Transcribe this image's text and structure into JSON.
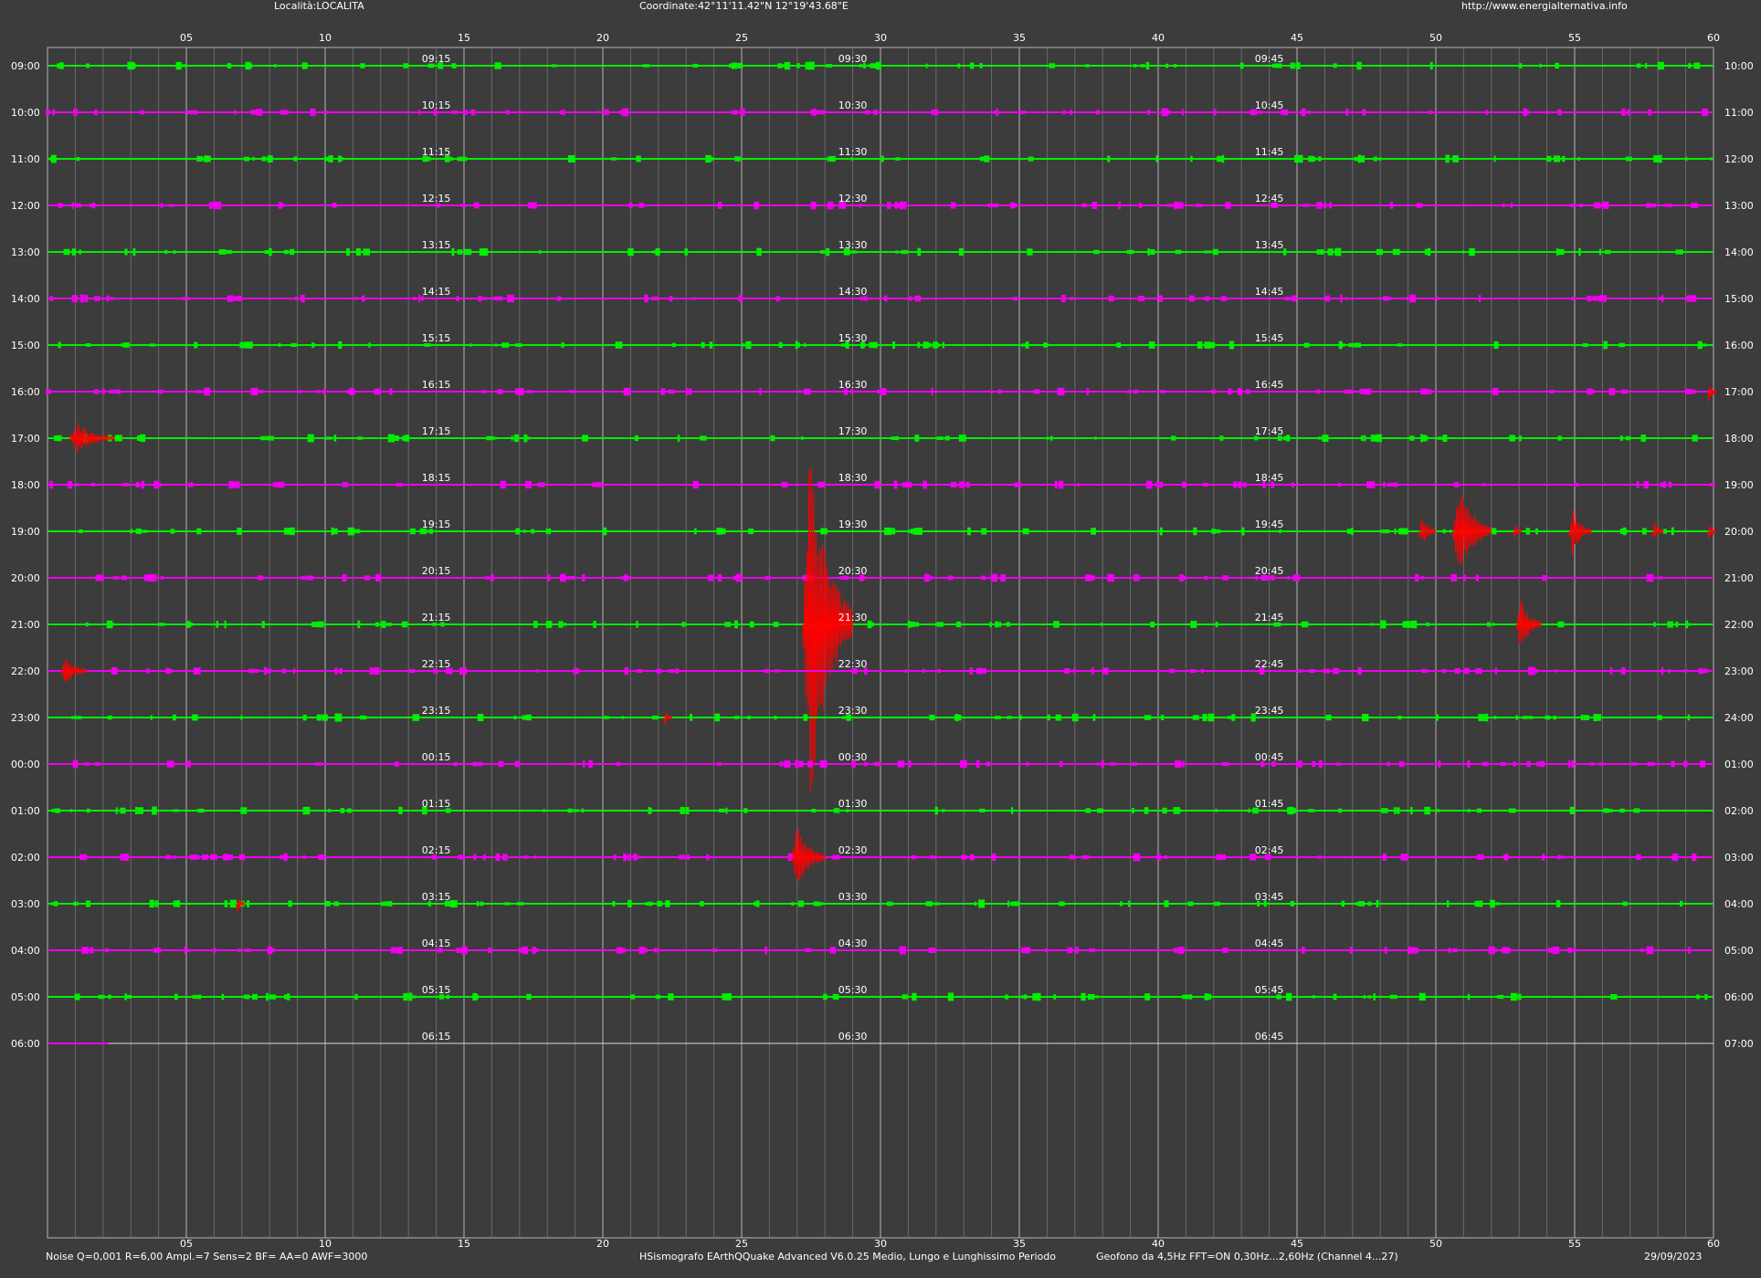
{
  "header": {
    "location": "Località:LOCALITA",
    "coordinates": "Coordinate:42°11'11.42\"N  12°19'43.68\"E",
    "website": "http://www.energialternativa.info"
  },
  "footer": {
    "params": "Noise Q=0,001 R=6,00 Ampl.=7 Sens=2 BF= AA=0 AWF=3000",
    "software": "HSismografo  EArthQQuake Advanced V6.0.25  Medio, Lungo e Lunghissimo Periodo",
    "sensor": "Geofono da 4,5Hz FFT=ON 0,30Hz...2,60Hz      (Channel 4...27)",
    "date": "29/09/2023"
  },
  "colors": {
    "background": "#3c3c3c",
    "trace_a": "#00ee00",
    "trace_b": "#ee00ee",
    "event": "#ff0000",
    "grid": "#b4b4b4"
  },
  "chart_data": {
    "type": "line",
    "x_tick_labels": [
      "05",
      "10",
      "15",
      "20",
      "25",
      "30",
      "35",
      "40",
      "45",
      "50",
      "55",
      "60"
    ],
    "xlim": [
      0,
      60
    ],
    "xlabel": "",
    "ylabel": "",
    "grid": true,
    "rows": [
      {
        "start": "09:00",
        "end": "10:00",
        "q15": "09:15",
        "q30": "09:30",
        "q45": "09:45",
        "events": []
      },
      {
        "start": "10:00",
        "end": "11:00",
        "q15": "10:15",
        "q30": "10:30",
        "q45": "10:45",
        "events": []
      },
      {
        "start": "11:00",
        "end": "12:00",
        "q15": "11:15",
        "q30": "11:30",
        "q45": "11:45",
        "events": []
      },
      {
        "start": "12:00",
        "end": "13:00",
        "q15": "12:15",
        "q30": "12:30",
        "q45": "12:45",
        "events": []
      },
      {
        "start": "13:00",
        "end": "14:00",
        "q15": "13:15",
        "q30": "13:30",
        "q45": "13:45",
        "events": []
      },
      {
        "start": "14:00",
        "end": "15:00",
        "q15": "14:15",
        "q30": "14:30",
        "q45": "14:45",
        "events": []
      },
      {
        "start": "15:00",
        "end": "16:00",
        "q15": "15:15",
        "q30": "15:30",
        "q45": "15:45",
        "events": []
      },
      {
        "start": "16:00",
        "end": "17:00",
        "q15": "16:15",
        "q30": "16:30",
        "q45": "16:45",
        "events": [
          {
            "minute": 59.8,
            "amplitude": 0.25,
            "duration": 0.3
          }
        ]
      },
      {
        "start": "17:00",
        "end": "18:00",
        "q15": "17:15",
        "q30": "17:30",
        "q45": "17:45",
        "events": [
          {
            "minute": 0.8,
            "amplitude": 0.35,
            "duration": 1.6
          }
        ]
      },
      {
        "start": "18:00",
        "end": "19:00",
        "q15": "18:15",
        "q30": "18:30",
        "q45": "18:45",
        "events": []
      },
      {
        "start": "19:00",
        "end": "20:00",
        "q15": "19:15",
        "q30": "19:30",
        "q45": "19:45",
        "events": [
          {
            "minute": 49.4,
            "amplitude": 0.35,
            "duration": 0.6
          },
          {
            "minute": 50.6,
            "amplitude": 1.1,
            "duration": 1.4
          },
          {
            "minute": 52.8,
            "amplitude": 0.2,
            "duration": 0.3
          },
          {
            "minute": 54.8,
            "amplitude": 0.55,
            "duration": 0.8
          },
          {
            "minute": 57.8,
            "amplitude": 0.25,
            "duration": 0.4
          },
          {
            "minute": 59.8,
            "amplitude": 0.2,
            "duration": 0.3
          }
        ]
      },
      {
        "start": "20:00",
        "end": "21:00",
        "q15": "20:15",
        "q30": "20:30",
        "q45": "20:45",
        "events": []
      },
      {
        "start": "21:00",
        "end": "22:00",
        "q15": "21:15",
        "q30": "21:30",
        "q45": "21:45",
        "events": [
          {
            "minute": 27.2,
            "amplitude": 3.9,
            "duration": 1.8
          },
          {
            "minute": 52.9,
            "amplitude": 0.65,
            "duration": 0.9
          }
        ]
      },
      {
        "start": "22:00",
        "end": "23:00",
        "q15": "22:15",
        "q30": "22:30",
        "q45": "22:45",
        "events": [
          {
            "minute": 0.5,
            "amplitude": 0.35,
            "duration": 0.9
          }
        ]
      },
      {
        "start": "23:00",
        "end": "24:00",
        "q15": "23:15",
        "q30": "23:30",
        "q45": "23:45",
        "events": [
          {
            "minute": 22.2,
            "amplitude": 0.2,
            "duration": 0.3
          }
        ]
      },
      {
        "start": "00:00",
        "end": "01:00",
        "q15": "00:15",
        "q30": "00:30",
        "q45": "00:45",
        "events": []
      },
      {
        "start": "01:00",
        "end": "02:00",
        "q15": "01:15",
        "q30": "01:30",
        "q45": "01:45",
        "events": []
      },
      {
        "start": "02:00",
        "end": "03:00",
        "q15": "02:15",
        "q30": "02:30",
        "q45": "02:45",
        "events": [
          {
            "minute": 26.8,
            "amplitude": 0.8,
            "duration": 1.2
          }
        ]
      },
      {
        "start": "03:00",
        "end": "04:00",
        "q15": "03:15",
        "q30": "03:30",
        "q45": "03:45",
        "events": [
          {
            "minute": 6.8,
            "amplitude": 0.2,
            "duration": 0.3
          }
        ]
      },
      {
        "start": "04:00",
        "end": "05:00",
        "q15": "04:15",
        "q30": "04:30",
        "q45": "04:45",
        "events": []
      },
      {
        "start": "05:00",
        "end": "06:00",
        "q15": "05:15",
        "q30": "05:30",
        "q45": "05:45",
        "events": []
      },
      {
        "start": "06:00",
        "end": "07:00",
        "q15": "06:15",
        "q30": "06:30",
        "q45": "06:45",
        "events": []
      }
    ]
  }
}
